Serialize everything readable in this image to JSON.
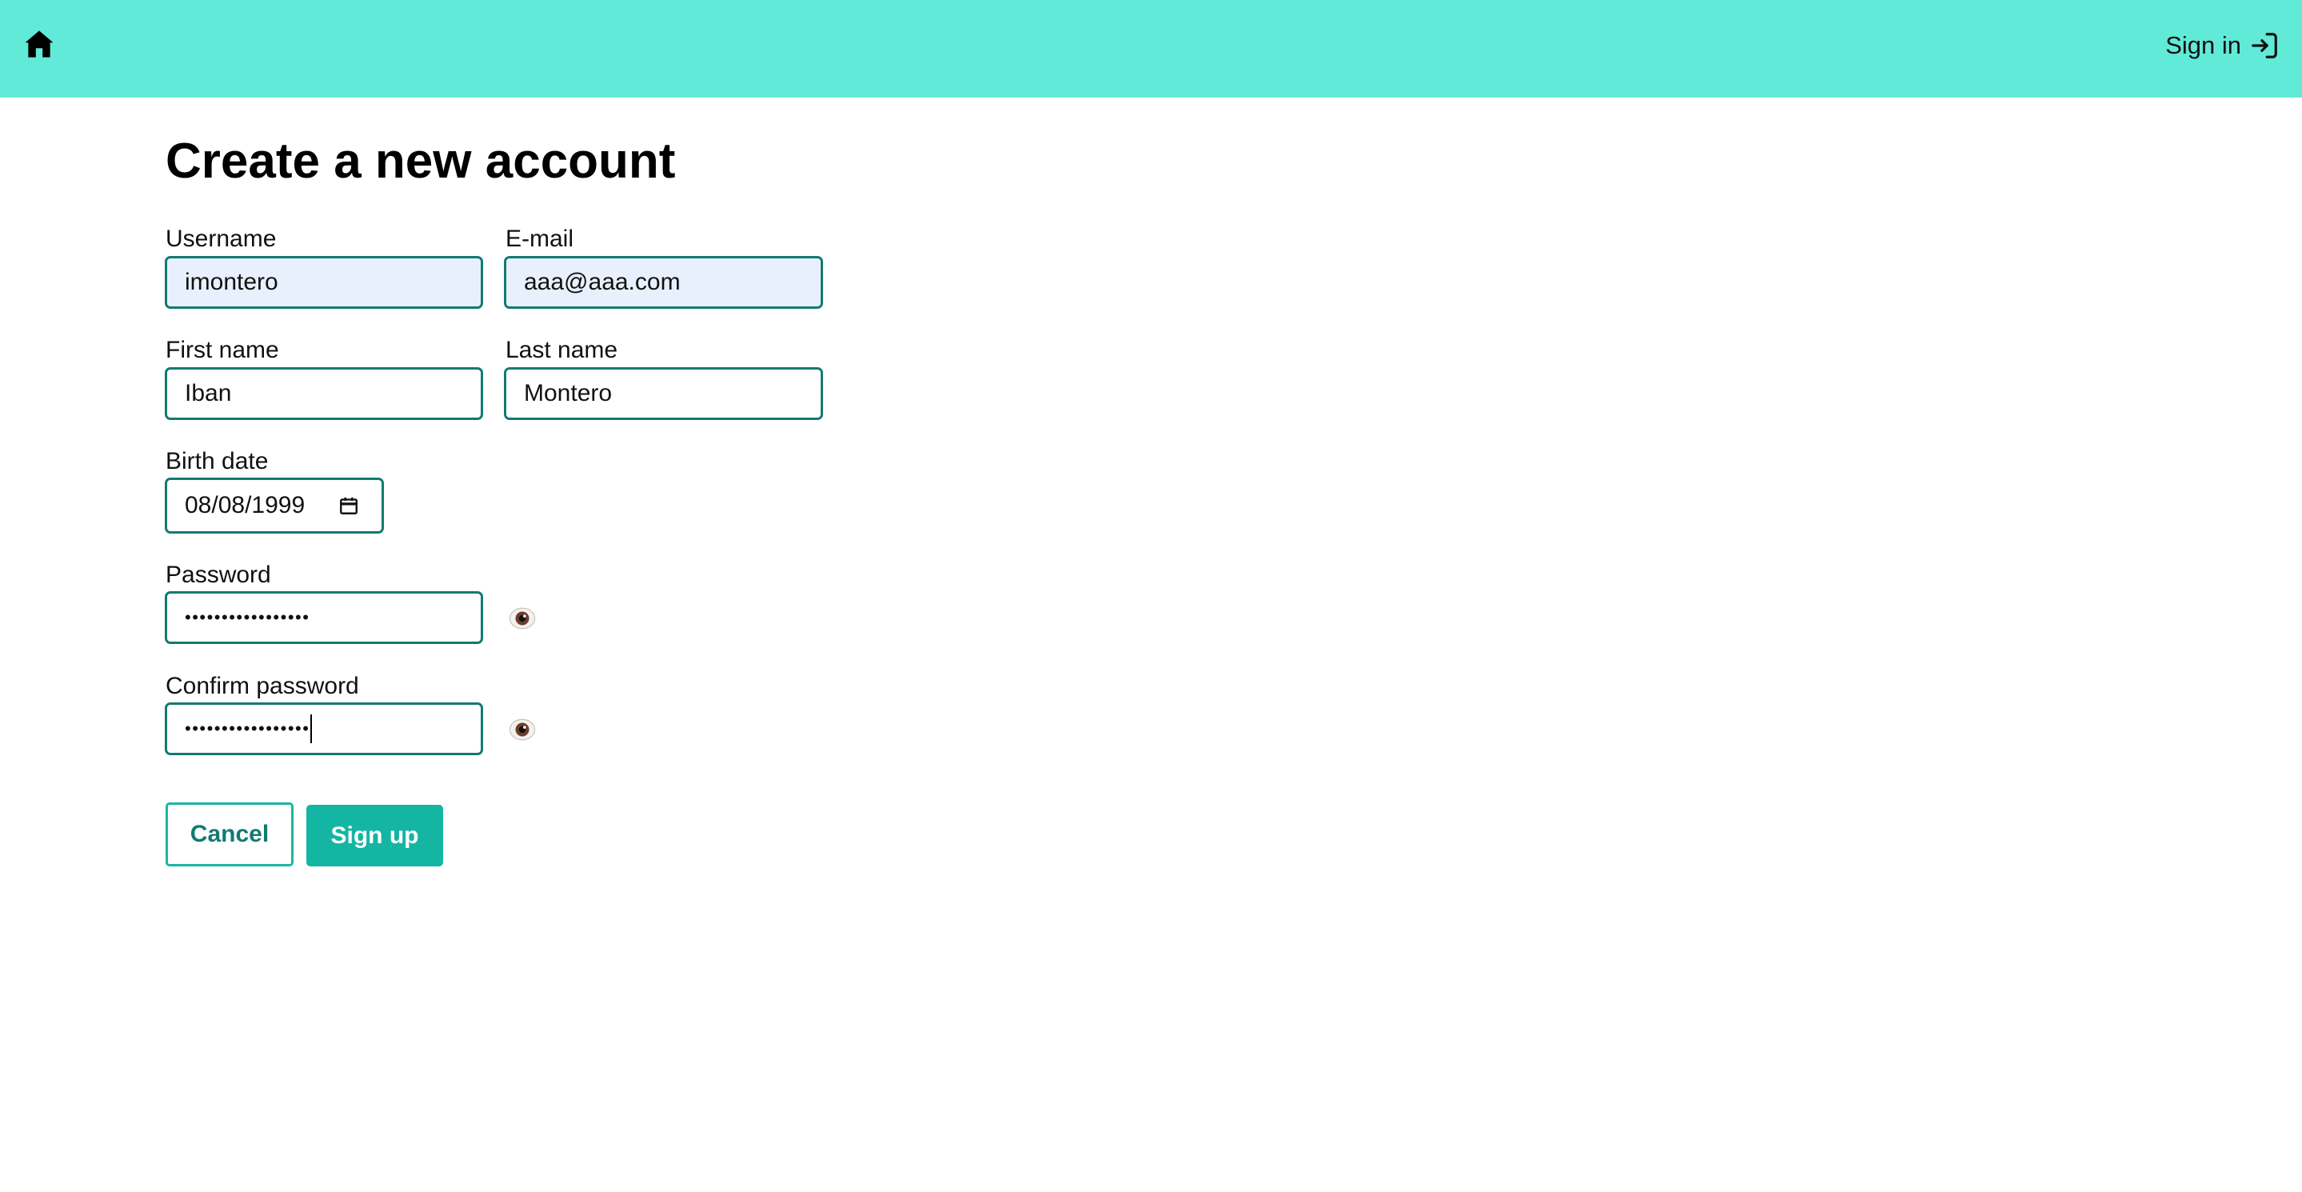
{
  "header": {
    "home_icon": "home-icon",
    "signin_label": "Sign in",
    "signin_icon": "sign-in-icon",
    "background_color": "#61ead7"
  },
  "form": {
    "title": "Create a new account",
    "username": {
      "label": "Username",
      "value": "imontero"
    },
    "email": {
      "label": "E-mail",
      "value": "aaa@aaa.com"
    },
    "first_name": {
      "label": "First name",
      "value": "Iban"
    },
    "last_name": {
      "label": "Last name",
      "value": "Montero"
    },
    "birth_date": {
      "label": "Birth date",
      "value": "08/08/1999",
      "icon": "calendar-icon"
    },
    "password": {
      "label": "Password",
      "masked_value": "•••••••••••••••••",
      "toggle_icon": "eye-icon"
    },
    "confirm_password": {
      "label": "Confirm password",
      "masked_value": "•••••••••••••••••",
      "toggle_icon": "eye-icon"
    }
  },
  "actions": {
    "cancel_label": "Cancel",
    "signup_label": "Sign up"
  },
  "colors": {
    "accent": "#14b6a3",
    "input_border": "#137a72",
    "autofill_background": "#e8f0fe"
  }
}
